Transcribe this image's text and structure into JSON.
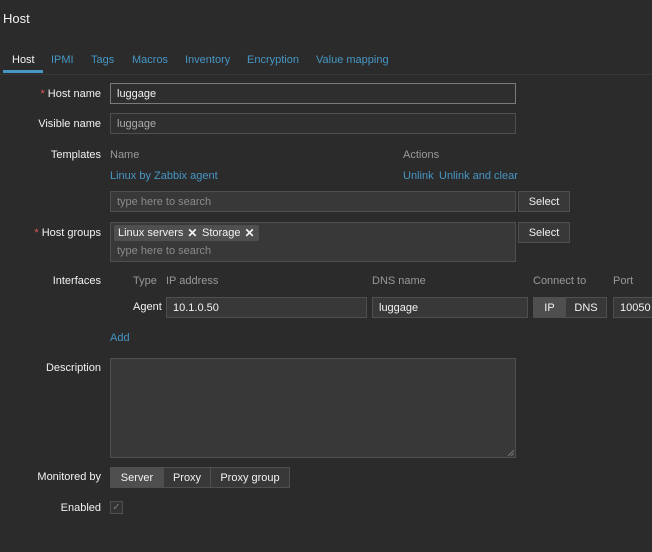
{
  "page": {
    "title": "Host"
  },
  "tabs": [
    {
      "label": "Host"
    },
    {
      "label": "IPMI"
    },
    {
      "label": "Tags"
    },
    {
      "label": "Macros"
    },
    {
      "label": "Inventory"
    },
    {
      "label": "Encryption"
    },
    {
      "label": "Value mapping"
    }
  ],
  "form": {
    "host_name": {
      "required_mark": "*",
      "label": "Host name",
      "value": "luggage"
    },
    "visible_name": {
      "label": "Visible name",
      "placeholder": "luggage"
    },
    "templates": {
      "label": "Templates",
      "col_name": "Name",
      "col_actions": "Actions",
      "linked": [
        {
          "name": "Linux by Zabbix agent",
          "unlink": "Unlink",
          "unlink_clear": "Unlink and clear"
        }
      ],
      "search_placeholder": "type here to search",
      "select_label": "Select"
    },
    "host_groups": {
      "required_mark": "*",
      "label": "Host groups",
      "tags": [
        "Linux servers",
        "Storage"
      ],
      "remove_glyph": "✕",
      "search_placeholder": "type here to search",
      "select_label": "Select"
    },
    "interfaces": {
      "label": "Interfaces",
      "headers": {
        "type": "Type",
        "ip": "IP address",
        "dns": "DNS name",
        "connect": "Connect to",
        "port": "Port"
      },
      "rows": [
        {
          "type": "Agent",
          "ip": "10.1.0.50",
          "dns": "luggage",
          "connect_ip": "IP",
          "connect_dns": "DNS",
          "port": "10050"
        }
      ],
      "add_label": "Add"
    },
    "description": {
      "label": "Description"
    },
    "monitored_by": {
      "label": "Monitored by",
      "options": [
        "Server",
        "Proxy",
        "Proxy group"
      ],
      "selected": "Server"
    },
    "enabled": {
      "label": "Enabled",
      "checked": true,
      "check_glyph": "✓"
    }
  }
}
